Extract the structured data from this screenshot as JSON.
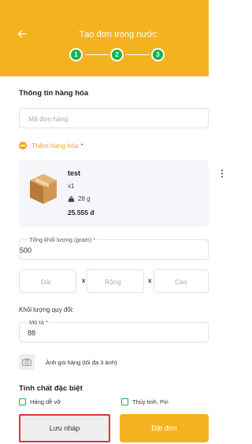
{
  "header": {
    "back_icon": "arrow-left-icon",
    "title": "Tạo đơn trong nước",
    "steps": [
      "1",
      "2",
      "3"
    ],
    "brand_color": "#f5b21f",
    "step_color": "#16b64b"
  },
  "goods_info": {
    "section_title": "Thông tin hàng hóa",
    "order_code_placeholder": "Mã đơn hàng",
    "add_goods_label": "Thêm hàng hóa",
    "required_mark": "*"
  },
  "product": {
    "name": "test",
    "quantity": "x1",
    "weight": "28 g",
    "price": "25.555 đ",
    "more_icon": "more-vertical-icon"
  },
  "total_weight": {
    "label": "Tổng khối lượng (gram)",
    "required_mark": "*",
    "value": "500"
  },
  "dimensions": {
    "length_placeholder": "Dài",
    "width_placeholder": "Rộng",
    "height_placeholder": "Cao",
    "separator": "x"
  },
  "converted_weight": {
    "label": "Khối lượng quy đổi:"
  },
  "description": {
    "label": "Mô tả",
    "required_mark": "*",
    "value": "88"
  },
  "photo": {
    "label": "Ảnh gói hàng (tối đa 3 ảnh)",
    "icon": "camera-icon"
  },
  "special": {
    "section_title": "Tính chất đặc biệt",
    "options": [
      "Hàng dễ vỡ",
      "Thủy tinh, Pin"
    ]
  },
  "footer": {
    "draft_label": "Lưu nháp",
    "order_label": "Đặt đơn",
    "highlight_color": "#d6353a"
  }
}
